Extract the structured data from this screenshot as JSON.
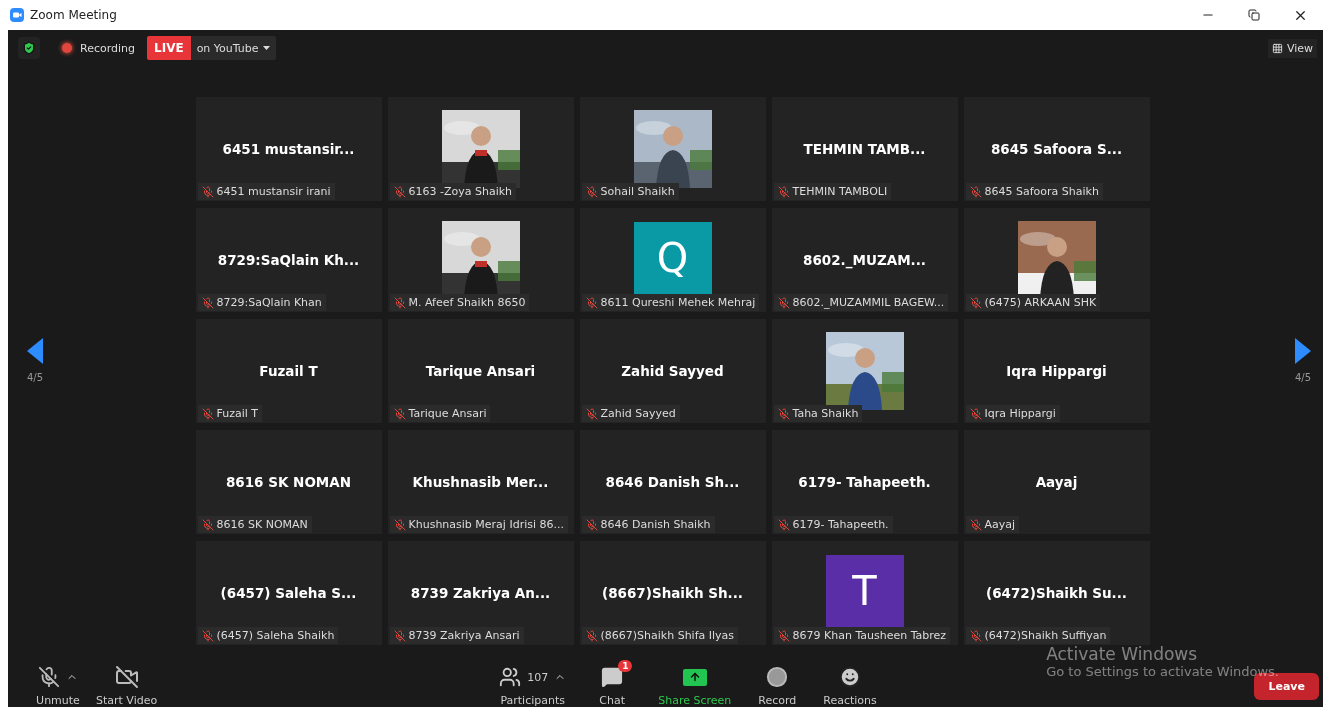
{
  "window": {
    "title": "Zoom Meeting"
  },
  "top_bar": {
    "recording": "Recording",
    "live_badge": "LIVE",
    "live_target": "on YouTube",
    "view_button": "View"
  },
  "pagination": {
    "left": "4/5",
    "right": "4/5"
  },
  "tiles": [
    {
      "kind": "name",
      "display": "6451 mustansir...",
      "label": "6451 mustansir irani",
      "muted": true
    },
    {
      "kind": "picture",
      "label": "6163 -Zoya Shaikh",
      "muted": true
    },
    {
      "kind": "picture",
      "label": "Sohail Shaikh",
      "muted": true
    },
    {
      "kind": "name",
      "display": "TEHMIN  TAMB...",
      "label": "TEHMIN TAMBOLI",
      "muted": true
    },
    {
      "kind": "name",
      "display": "8645  Safoora S...",
      "label": "8645  Safoora Shaikh",
      "muted": true
    },
    {
      "kind": "name",
      "display": "8729:SaQlain  Kh...",
      "label": "8729:SaQlain Khan",
      "muted": true
    },
    {
      "kind": "picture",
      "label": "M.  Afeef Shaikh 8650",
      "muted": true
    },
    {
      "kind": "avatar",
      "letter": "Q",
      "color": "#0a9aa6",
      "label": "8611 Qureshi Mehek Mehraj",
      "muted": true
    },
    {
      "kind": "name",
      "display": "8602._MUZAM...",
      "label": "8602._MUZAMMIL BAGEW...",
      "muted": true
    },
    {
      "kind": "picture",
      "label": "(6475) ARKAAN SHK",
      "muted": true
    },
    {
      "kind": "name",
      "display": "Fuzail T",
      "label": "Fuzail T",
      "muted": true
    },
    {
      "kind": "name",
      "display": "Tarique Ansari",
      "label": "Tarique Ansari",
      "muted": true
    },
    {
      "kind": "name",
      "display": "Zahid Sayyed",
      "label": "Zahid Sayyed",
      "muted": true
    },
    {
      "kind": "picture",
      "label": "Taha Shaikh",
      "muted": true
    },
    {
      "kind": "name",
      "display": "Iqra Hippargi",
      "label": "Iqra Hippargi",
      "muted": true
    },
    {
      "kind": "name",
      "display": "8616 SK NOMAN",
      "label": "8616 SK NOMAN",
      "muted": true
    },
    {
      "kind": "name",
      "display": "Khushnasib  Mer...",
      "label": "Khushnasib Meraj Idrisi 86...",
      "muted": true
    },
    {
      "kind": "name",
      "display": "8646  Danish  Sh...",
      "label": "8646 Danish Shaikh",
      "muted": true
    },
    {
      "kind": "name",
      "display": "6179- Tahapeeth.",
      "label": "6179- Tahapeeth.",
      "muted": true
    },
    {
      "kind": "name",
      "display": "Aayaj",
      "label": "Aayaj",
      "muted": true
    },
    {
      "kind": "name",
      "display": "(6457)  Saleha S...",
      "label": "(6457) Saleha Shaikh",
      "muted": true
    },
    {
      "kind": "name",
      "display": "8739  Zakriya An...",
      "label": "8739 Zakriya Ansari",
      "muted": true
    },
    {
      "kind": "name",
      "display": "(8667)Shaikh  Sh...",
      "label": "(8667)Shaikh Shifa Ilyas",
      "muted": true
    },
    {
      "kind": "avatar",
      "letter": "T",
      "color": "#5a2ea6",
      "label": "8679 Khan Tausheen Tabrez",
      "muted": true
    },
    {
      "kind": "name",
      "display": "(6472)Shaikh  Su...",
      "label": "(6472)Shaikh Suffiyan",
      "muted": true
    }
  ],
  "toolbar": {
    "left": [
      {
        "kind": "unmute",
        "label": "Unmute"
      },
      {
        "kind": "video",
        "label": "Start Video"
      }
    ],
    "center": [
      {
        "kind": "participants",
        "label": "Participants",
        "count": "107"
      },
      {
        "kind": "chat",
        "label": "Chat",
        "badge": "1"
      },
      {
        "kind": "share",
        "label": "Share Screen"
      },
      {
        "kind": "record",
        "label": "Record"
      },
      {
        "kind": "reactions",
        "label": "Reactions"
      }
    ],
    "leave": "Leave"
  },
  "os_notice": {
    "title": "Activate Windows",
    "message": "Go to Settings to activate Windows."
  }
}
